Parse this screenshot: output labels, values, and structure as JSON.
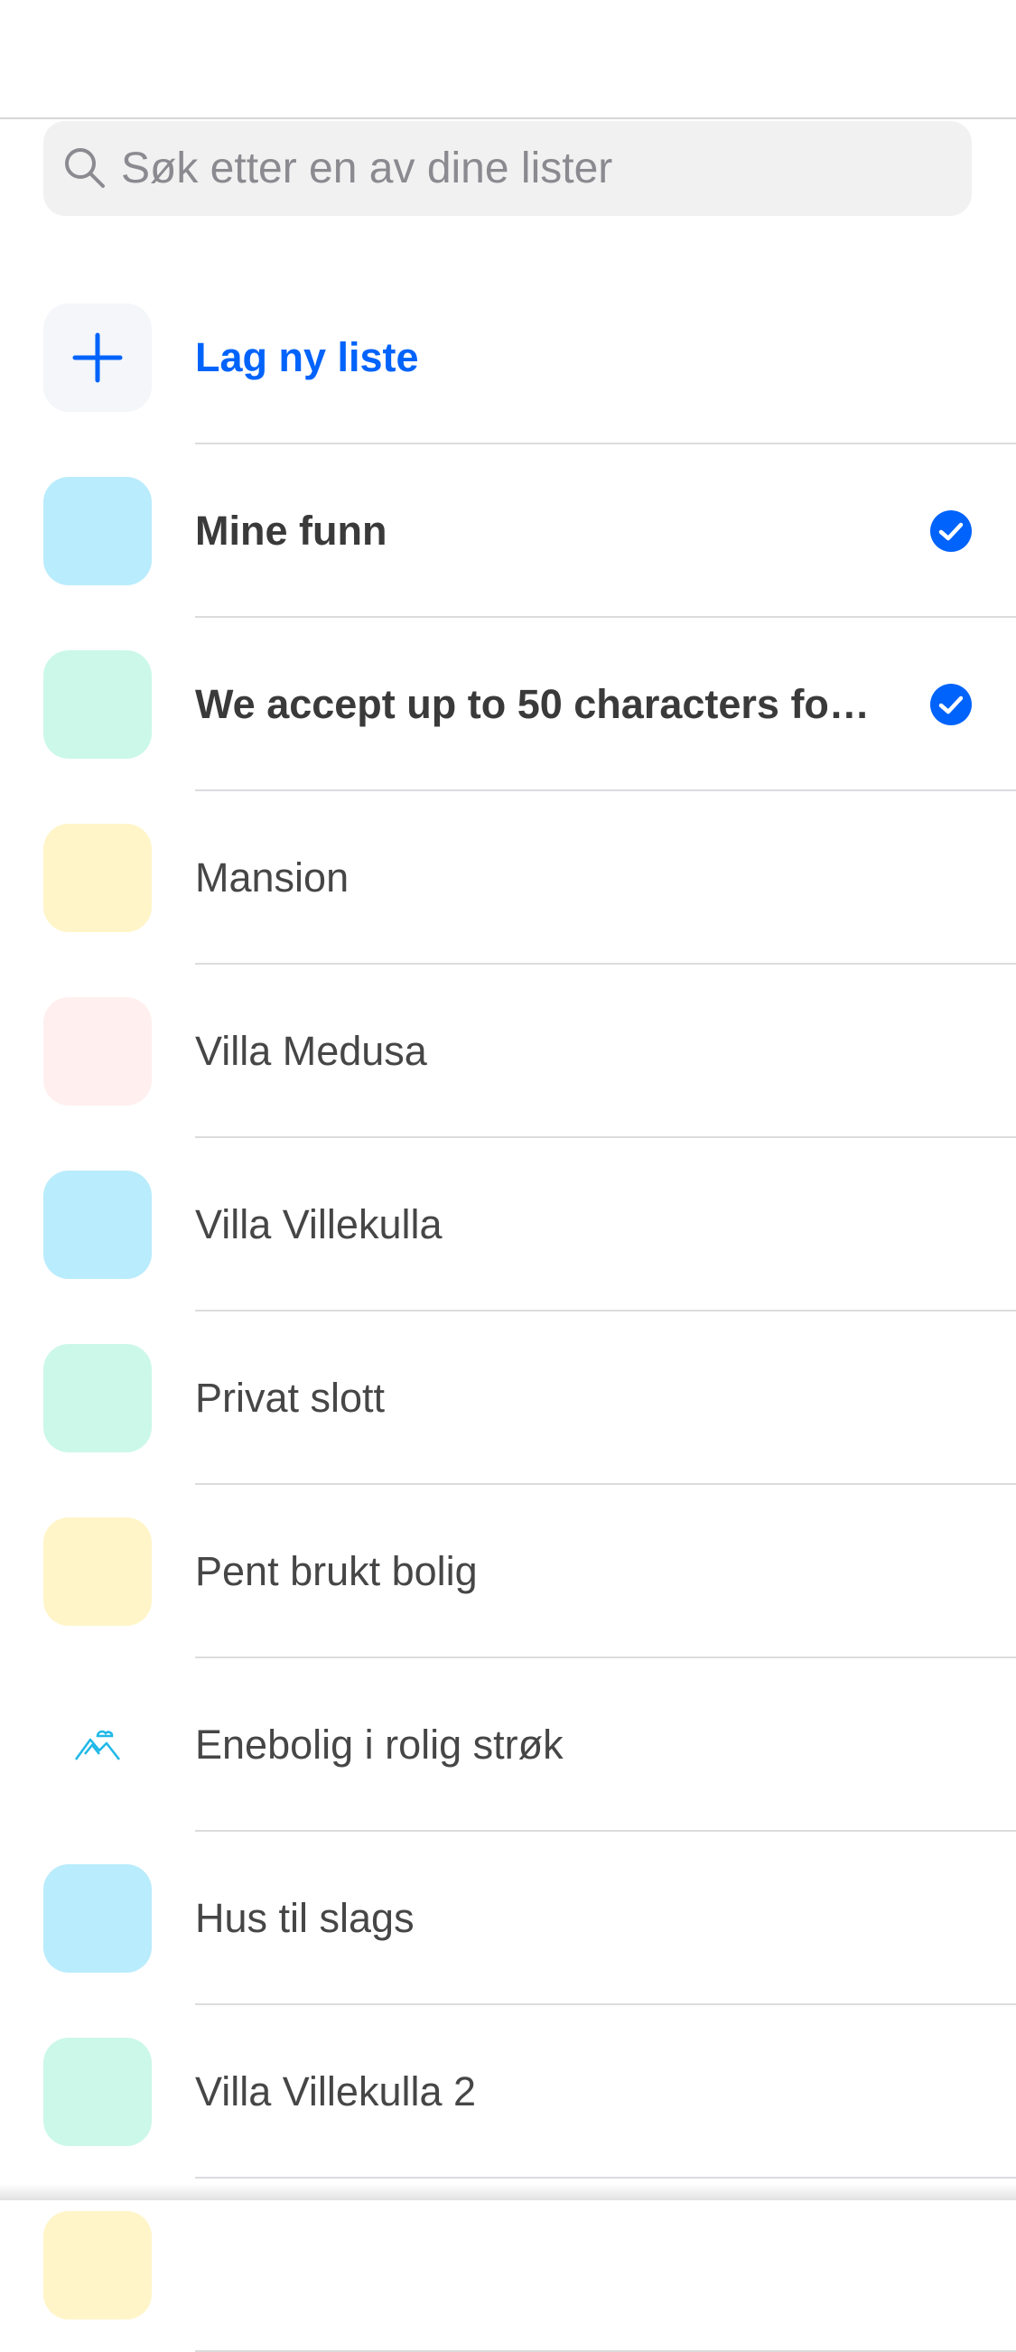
{
  "search": {
    "placeholder": "Søk etter en av dine lister",
    "value": ""
  },
  "create": {
    "label": "Lag ny liste",
    "accent": "#0063fb",
    "icon_bg": "#f4f6f9"
  },
  "lists": [
    {
      "name": "Mine funn",
      "color": "#b9ecfc",
      "selected": true,
      "icon": "color-swatch"
    },
    {
      "name": "We accept up to 50 characters for…",
      "color": "#ccf8e9",
      "selected": true,
      "icon": "color-swatch"
    },
    {
      "name": "Mansion",
      "color": "#fff5c8",
      "selected": false,
      "icon": "color-swatch"
    },
    {
      "name": "Villa Medusa",
      "color": "#fff0ef",
      "selected": false,
      "icon": "color-swatch"
    },
    {
      "name": "Villa Villekulla",
      "color": "#b9ecfc",
      "selected": false,
      "icon": "color-swatch"
    },
    {
      "name": "Privat slott",
      "color": "#ccf8e9",
      "selected": false,
      "icon": "color-swatch"
    },
    {
      "name": "Pent brukt bolig",
      "color": "#fff5c8",
      "selected": false,
      "icon": "color-swatch"
    },
    {
      "name": "Enebolig i rolig strøk",
      "color": "#ffffff",
      "selected": false,
      "icon": "image-placeholder-icon"
    },
    {
      "name": "Hus til slags",
      "color": "#b9ecfc",
      "selected": false,
      "icon": "color-swatch"
    },
    {
      "name": "Villa Villekulla 2",
      "color": "#ccf8e9",
      "selected": false,
      "icon": "color-swatch"
    },
    {
      "name": "",
      "color": "#fff5c8",
      "selected": false,
      "icon": "color-swatch"
    }
  ],
  "colors": {
    "check": "#0063fb",
    "text": "#464646",
    "divider": "#dcdcdf"
  }
}
